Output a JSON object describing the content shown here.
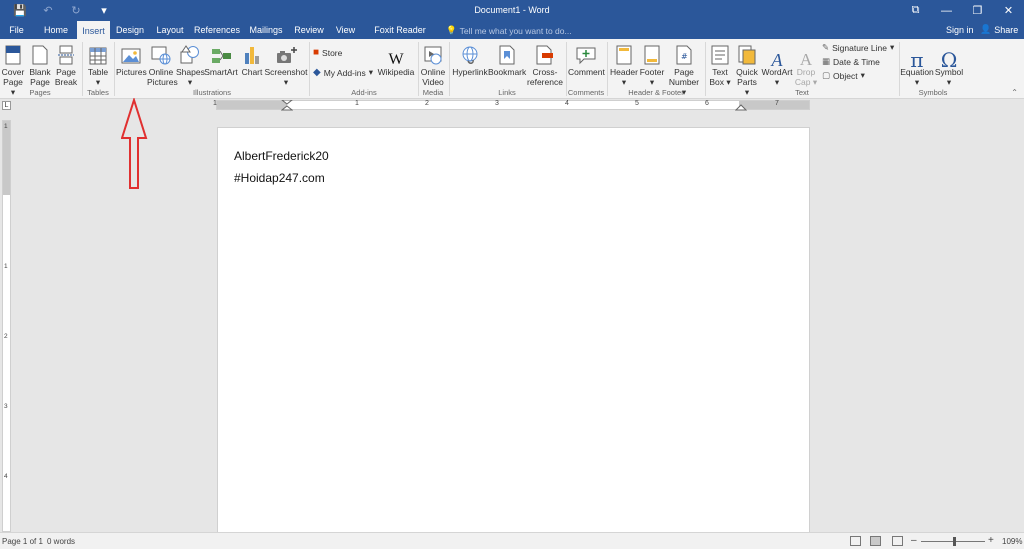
{
  "window": {
    "title": "Document1 - Word",
    "qat_save": "💾",
    "qat_undo": "↶",
    "qat_redo": "↻",
    "qat_custom": "▾",
    "help_icon": "⧉",
    "minimize": "—",
    "restore": "❐",
    "close": "✕"
  },
  "tabs": [
    {
      "label": "File"
    },
    {
      "label": "Home"
    },
    {
      "label": "Insert"
    },
    {
      "label": "Design"
    },
    {
      "label": "Layout"
    },
    {
      "label": "References"
    },
    {
      "label": "Mailings"
    },
    {
      "label": "Review"
    },
    {
      "label": "View"
    },
    {
      "label": "Foxit Reader PDF"
    }
  ],
  "active_tab": "Insert",
  "tell_me": "Tell me what you want to do...",
  "sign_in": "Sign in",
  "share": "Share",
  "ribbon": {
    "cover_page": [
      "Cover",
      "Page ▾"
    ],
    "blank_page": [
      "Blank",
      "Page"
    ],
    "page_break": [
      "Page",
      "Break"
    ],
    "table": [
      "Table",
      "▾"
    ],
    "pictures": [
      "Pictures"
    ],
    "online_pictures": [
      "Online",
      "Pictures"
    ],
    "shapes": [
      "Shapes",
      "▾"
    ],
    "smartart": [
      "SmartArt"
    ],
    "chart": [
      "Chart"
    ],
    "screenshot": [
      "Screenshot",
      "▾"
    ],
    "store": "Store",
    "my_addins": "My Add-ins",
    "wikipedia": [
      "Wikipedia"
    ],
    "online_video": [
      "Online",
      "Video"
    ],
    "hyperlink": [
      "Hyperlink"
    ],
    "bookmark": [
      "Bookmark"
    ],
    "cross_reference": [
      "Cross-",
      "reference"
    ],
    "comment": [
      "Comment"
    ],
    "header": [
      "Header",
      "▾"
    ],
    "footer": [
      "Footer",
      "▾"
    ],
    "page_number": [
      "Page",
      "Number ▾"
    ],
    "text_box": [
      "Text",
      "Box ▾"
    ],
    "quick_parts": [
      "Quick",
      "Parts ▾"
    ],
    "wordart": [
      "WordArt",
      "▾"
    ],
    "drop_cap": [
      "Drop",
      "Cap ▾"
    ],
    "signature_line": "Signature Line",
    "date_time": "Date & Time",
    "object": "Object",
    "equation": [
      "Equation",
      "▾"
    ],
    "symbol": [
      "Symbol",
      "▾"
    ],
    "groups": {
      "pages": "Pages",
      "tables": "Tables",
      "illustrations": "Illustrations",
      "addins": "Add-ins",
      "media": "Media",
      "links": "Links",
      "comments": "Comments",
      "header_footer": "Header & Footer",
      "text": "Text",
      "symbols": "Symbols"
    }
  },
  "ruler": {
    "h_numbers": [
      "1",
      "1",
      "2",
      "3",
      "4",
      "5",
      "6",
      "7"
    ],
    "v_numbers": [
      "1",
      "1",
      "2",
      "3",
      "4"
    ],
    "tab_selector": "L"
  },
  "document": {
    "lines": [
      "AlbertFrederick20",
      "#Hoidap247.com"
    ]
  },
  "statusbar": {
    "page": "Page 1 of 1",
    "words": "0 words",
    "zoom": "109%",
    "zoom_out": "–",
    "zoom_in": "+"
  },
  "colors": {
    "accent": "#2b579a",
    "arrow": "#e03030"
  }
}
